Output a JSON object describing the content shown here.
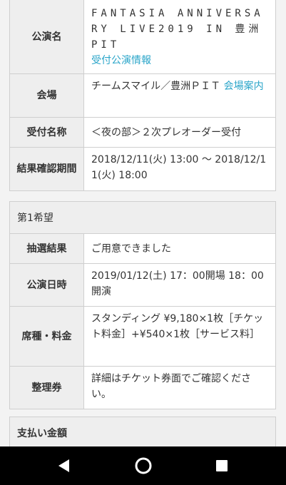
{
  "performance": {
    "rows": [
      {
        "label": "公演名",
        "value": "FANTASIA ANNIVERSARY LIVE2019 IN 豊洲PIT",
        "link": "受付公演情報"
      },
      {
        "label": "会場",
        "value": "チームスマイル／豊洲ＰＩＴ",
        "link": "会場案内"
      },
      {
        "label": "受付名称",
        "value": "＜夜の部＞２次プレオーダー受付"
      },
      {
        "label": "結果確認期間",
        "value": "2018/12/11(火) 13:00 〜 2018/12/11(火) 18:00"
      }
    ]
  },
  "choice1": {
    "header": "第1希望",
    "rows": [
      {
        "label": "抽選結果",
        "value": "ご用意できました"
      },
      {
        "label": "公演日時",
        "value": "2019/01/12(土) 17：00開場 18：00開演"
      },
      {
        "label": "席種・料金",
        "value": "スタンディング ¥9,180×1枚［チケット料金］+¥540×1枚［サービス料］"
      },
      {
        "label": "整理券",
        "value": "詳細はチケット券面でご確認ください。"
      }
    ]
  },
  "payment": {
    "header": "支払い金額"
  },
  "navbar": {
    "icons": [
      "back-triangle-icon",
      "home-circle-icon",
      "recents-square-icon"
    ]
  }
}
